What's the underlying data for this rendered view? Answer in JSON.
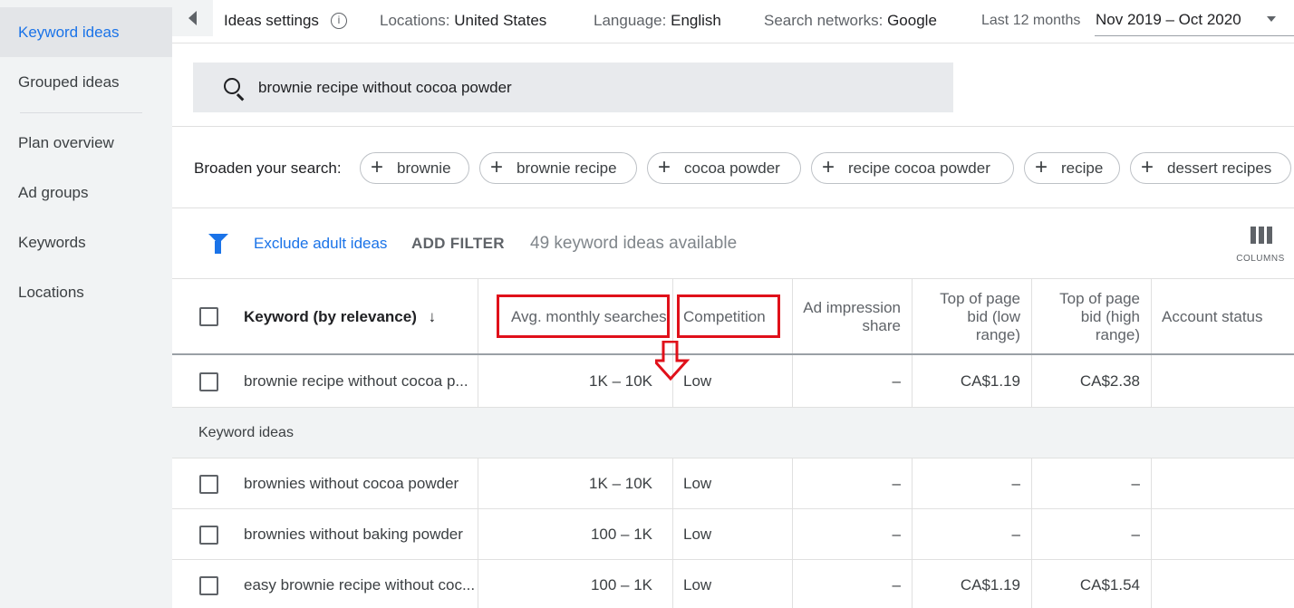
{
  "sidebar": {
    "items": [
      {
        "label": "Keyword ideas"
      },
      {
        "label": "Grouped ideas"
      },
      {
        "label": "Plan overview"
      },
      {
        "label": "Ad groups"
      },
      {
        "label": "Keywords"
      },
      {
        "label": "Locations"
      }
    ]
  },
  "topbar": {
    "ideas_settings": "Ideas settings",
    "locations_label": "Locations:",
    "locations_value": "United States",
    "language_label": "Language:",
    "language_value": "English",
    "networks_label": "Search networks:",
    "networks_value": "Google",
    "period_label": "Last 12 months",
    "date_range": "Nov 2019 – Oct 2020"
  },
  "search": {
    "value": "brownie recipe without cocoa powder"
  },
  "broaden": {
    "label": "Broaden your search:",
    "chips": [
      "brownie",
      "brownie recipe",
      "cocoa powder",
      "recipe cocoa powder",
      "recipe",
      "dessert recipes"
    ]
  },
  "filter": {
    "exclude_label": "Exclude adult ideas",
    "add_filter": "ADD FILTER",
    "available": "49 keyword ideas available",
    "columns_label": "COLUMNS"
  },
  "table": {
    "headers": {
      "keyword": "Keyword (by relevance)",
      "avg_monthly": "Avg. monthly searches",
      "competition": "Competition",
      "ad_impression": [
        "Ad impression",
        "share"
      ],
      "bid_low": [
        "Top of page",
        "bid (low",
        "range)"
      ],
      "bid_high": [
        "Top of page",
        "bid (high",
        "range)"
      ],
      "account_status": "Account status"
    },
    "provided_row": {
      "keyword": "brownie recipe without cocoa p...",
      "avg": "1K – 10K",
      "competition": "Low",
      "ad_impression": "–",
      "bid_low": "CA$1.19",
      "bid_high": "CA$2.38"
    },
    "group_label": "Keyword ideas",
    "rows": [
      {
        "keyword": "brownies without cocoa powder",
        "avg": "1K – 10K",
        "competition": "Low",
        "ad_impression": "–",
        "bid_low": "–",
        "bid_high": "–"
      },
      {
        "keyword": "brownies without baking powder",
        "avg": "100 – 1K",
        "competition": "Low",
        "ad_impression": "–",
        "bid_low": "–",
        "bid_high": "–"
      },
      {
        "keyword": "easy brownie recipe without coc...",
        "avg": "100 – 1K",
        "competition": "Low",
        "ad_impression": "–",
        "bid_low": "CA$1.19",
        "bid_high": "CA$1.54"
      }
    ]
  },
  "colors": {
    "accent": "#1a73e8",
    "annotation": "#e0101a",
    "sidebar_bg": "#f1f3f4"
  }
}
